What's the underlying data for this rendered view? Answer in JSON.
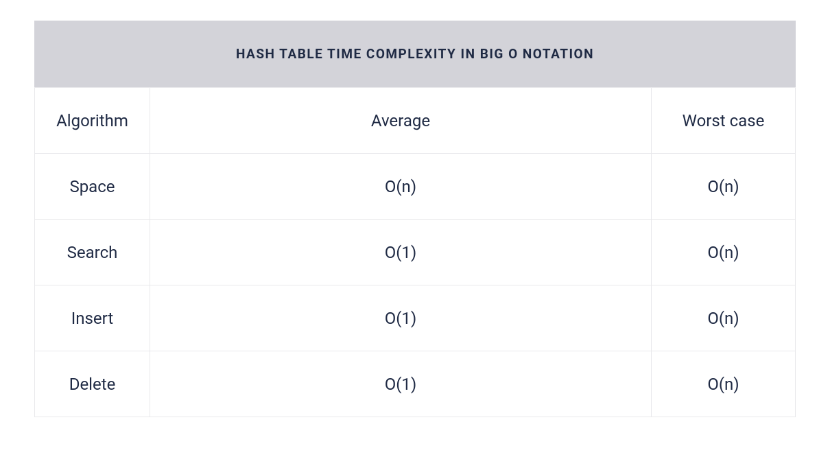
{
  "table": {
    "caption": "HASH TABLE TIME COMPLEXITY IN BIG O NOTATION",
    "headers": [
      "Algorithm",
      "Average",
      "Worst case"
    ],
    "rows": [
      {
        "algorithm": "Space",
        "average": "O(n)",
        "worst": "O(n)"
      },
      {
        "algorithm": "Search",
        "average": "O(1)",
        "worst": "O(n)"
      },
      {
        "algorithm": "Insert",
        "average": "O(1)",
        "worst": "O(n)"
      },
      {
        "algorithm": "Delete",
        "average": "O(1)",
        "worst": "O(n)"
      }
    ]
  }
}
